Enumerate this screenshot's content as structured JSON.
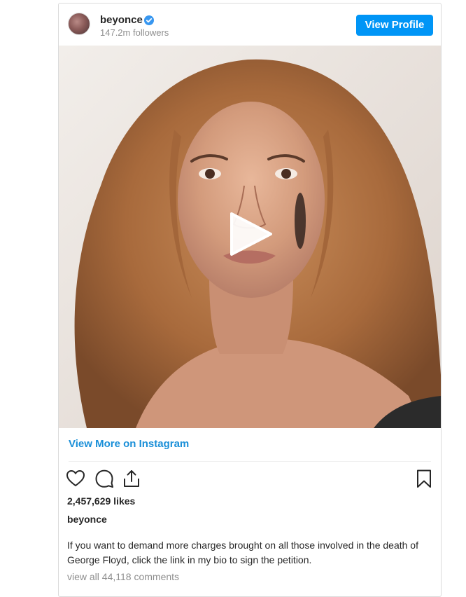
{
  "header": {
    "username": "beyonce",
    "followers": "147.2m followers",
    "view_profile_label": "View Profile",
    "verified_icon": "verified-badge-icon"
  },
  "media": {
    "type": "video",
    "play_icon": "play-icon"
  },
  "footer": {
    "view_more_label": "View More on Instagram",
    "actions": [
      "heart-icon",
      "comment-icon",
      "share-icon",
      "bookmark-icon"
    ],
    "likes": "2,457,629 likes",
    "caption_user": "beyonce",
    "caption_text": "If you want to demand more charges brought on all those involved in the death of George Floyd, click the link in my bio to sign the petition.",
    "view_comments": "view all 44,118 comments"
  },
  "colors": {
    "accent": "#0095f6",
    "link": "#1a8fd8",
    "text": "#262626",
    "muted": "#8e8e8e"
  }
}
